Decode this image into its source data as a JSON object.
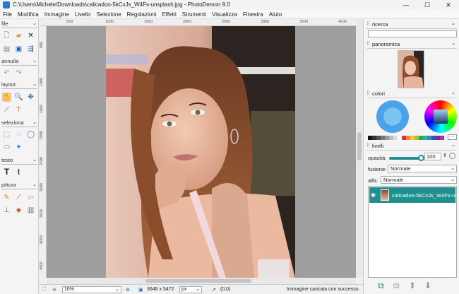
{
  "window": {
    "title": "C:\\Users\\Michele\\Downloads\\calicadoo-5kCxJs_W4Fs-unsplash.jpg  -  PhotoDemon 9.0",
    "minimize": "—",
    "maximize": "☐",
    "close": "✕"
  },
  "menu": [
    "File",
    "Modifica",
    "Immagine",
    "Livello",
    "Selezione",
    "Regolazioni",
    "Effetti",
    "Strumenti",
    "Visualizza",
    "Finestra",
    "Aiuto"
  ],
  "toolbox": {
    "file": "file",
    "annulla": "annulla",
    "layout": "layout",
    "seleziona": "seleziona",
    "testo": "testo",
    "pittura": "pittura"
  },
  "ruler": {
    "top": [
      "500",
      "1000",
      "1500",
      "2000",
      "2500",
      "3000",
      "3500",
      "4000"
    ],
    "left": [
      "500",
      "1000",
      "1500",
      "2000",
      "2500",
      "3000",
      "3500",
      "4000",
      "4500"
    ]
  },
  "status": {
    "zoom": "16%",
    "size": "3648 x 5472",
    "unit": "px",
    "coords": "(0,0)",
    "message": "Immagine caricata con successo."
  },
  "panels": {
    "ricerca": "ricerca",
    "panoramica": "panoramica",
    "colori": "colori",
    "livelli": "livelli",
    "opacity_label": "opacità:",
    "opacity_value": "100",
    "opacity_level": 1.0,
    "fusione_label": "fusione:",
    "fusione_value": "Normale",
    "alfa_label": "alfa:",
    "alfa_value": "Normale",
    "layer_name": "calicadoo-5kCxJs_W4Fs-unsplas",
    "palette_more": "···"
  },
  "colors": {
    "accent": "#1f8f8f",
    "selected_tool": "#f3c69a",
    "canvas_bg": "#9e9e9e",
    "primary_color": "#4aa3e8"
  }
}
